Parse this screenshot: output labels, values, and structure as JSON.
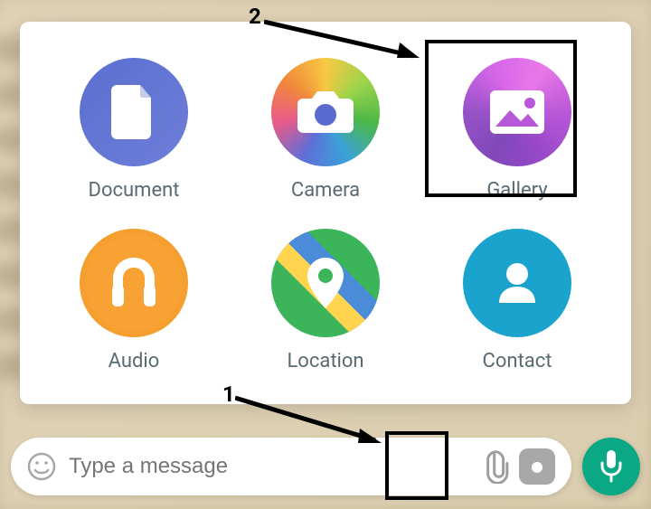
{
  "attach_options": {
    "document": {
      "label": "Document"
    },
    "camera": {
      "label": "Camera"
    },
    "gallery": {
      "label": "Gallery"
    },
    "audio": {
      "label": "Audio"
    },
    "location": {
      "label": "Location"
    },
    "contact": {
      "label": "Contact"
    }
  },
  "input": {
    "placeholder": "Type a message"
  },
  "annotations": {
    "step1": "1",
    "step2": "2"
  }
}
